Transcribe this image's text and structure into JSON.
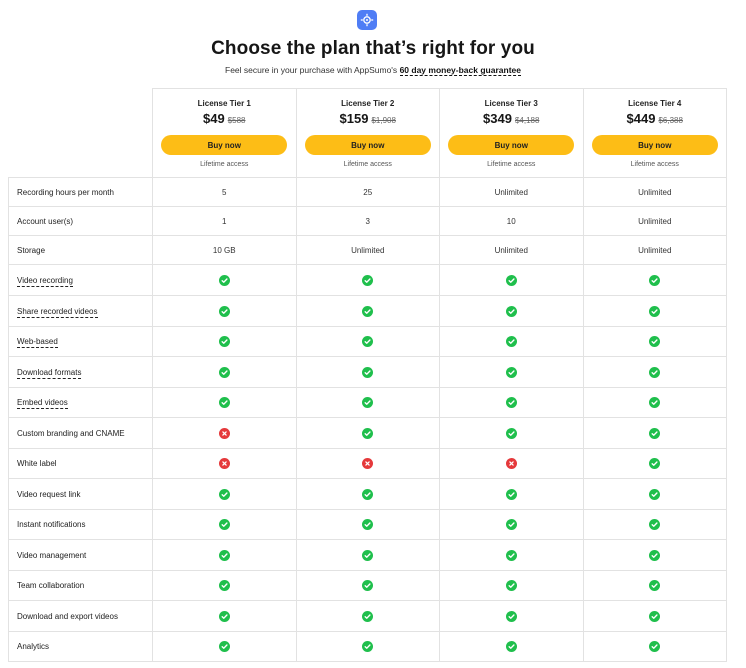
{
  "header": {
    "logo_icon": "crosshair-target-icon",
    "title": "Choose the plan that’s right for you",
    "subtitle": "Feel secure in your purchase with AppSumo's",
    "guarantee": "60 day money-back guarantee",
    "accent_color": "#4f7df5"
  },
  "tiers": [
    {
      "name": "License Tier 1",
      "price": "$49",
      "old_price": "$588",
      "button": "Buy now",
      "note": "Lifetime access"
    },
    {
      "name": "License Tier 2",
      "price": "$159",
      "old_price": "$1,908",
      "button": "Buy now",
      "note": "Lifetime access"
    },
    {
      "name": "License Tier 3",
      "price": "$349",
      "old_price": "$4,188",
      "button": "Buy now",
      "note": "Lifetime access"
    },
    {
      "name": "License Tier 4",
      "price": "$449",
      "old_price": "$6,388",
      "button": "Buy now",
      "note": "Lifetime access"
    }
  ],
  "button_color": "#fdbd16",
  "features": [
    {
      "label": "Recording hours per month",
      "dashed": false,
      "values": [
        "5",
        "25",
        "Unlimited",
        "Unlimited"
      ]
    },
    {
      "label": "Account user(s)",
      "dashed": false,
      "values": [
        "1",
        "3",
        "10",
        "Unlimited"
      ]
    },
    {
      "label": "Storage",
      "dashed": false,
      "values": [
        "10 GB",
        "Unlimited",
        "Unlimited",
        "Unlimited"
      ]
    },
    {
      "label": "Video recording",
      "dashed": true,
      "values": [
        true,
        true,
        true,
        true
      ]
    },
    {
      "label": "Share recorded videos",
      "dashed": true,
      "values": [
        true,
        true,
        true,
        true
      ]
    },
    {
      "label": "Web-based",
      "dashed": true,
      "values": [
        true,
        true,
        true,
        true
      ]
    },
    {
      "label": "Download formats",
      "dashed": true,
      "values": [
        true,
        true,
        true,
        true
      ]
    },
    {
      "label": "Embed videos",
      "dashed": true,
      "values": [
        true,
        true,
        true,
        true
      ]
    },
    {
      "label": "Custom branding and CNAME",
      "dashed": false,
      "values": [
        false,
        true,
        true,
        true
      ]
    },
    {
      "label": "White label",
      "dashed": false,
      "values": [
        false,
        false,
        false,
        true
      ]
    },
    {
      "label": "Video request link",
      "dashed": false,
      "values": [
        true,
        true,
        true,
        true
      ]
    },
    {
      "label": "Instant notifications",
      "dashed": false,
      "values": [
        true,
        true,
        true,
        true
      ]
    },
    {
      "label": "Video management",
      "dashed": false,
      "values": [
        true,
        true,
        true,
        true
      ]
    },
    {
      "label": "Team collaboration",
      "dashed": false,
      "values": [
        true,
        true,
        true,
        true
      ]
    },
    {
      "label": "Download and export videos",
      "dashed": false,
      "values": [
        true,
        true,
        true,
        true
      ]
    },
    {
      "label": "Analytics",
      "dashed": false,
      "values": [
        true,
        true,
        true,
        true
      ]
    }
  ],
  "icons": {
    "included": "check-circle-icon",
    "excluded": "x-circle-icon"
  },
  "status_colors": {
    "included": "#1fbf4c",
    "excluded": "#e5393b"
  }
}
